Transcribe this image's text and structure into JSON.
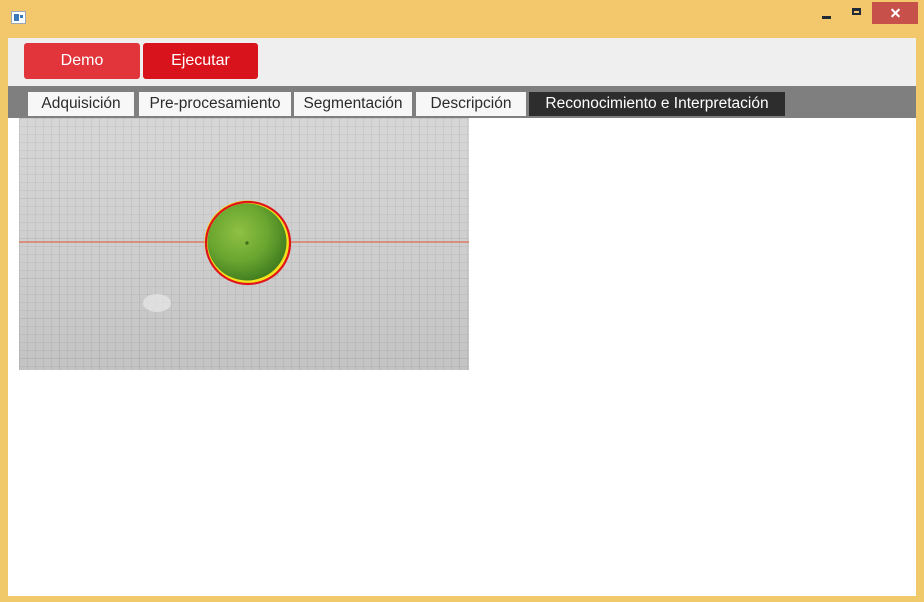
{
  "window": {
    "title": "",
    "icons": {
      "app": "app-icon",
      "minimize": "minimize-icon",
      "maximize": "maximize-icon",
      "close": "close-icon"
    },
    "colors": {
      "titlebar": "#f3c76c",
      "close_button": "#c7504b"
    }
  },
  "toolbar": {
    "buttons": [
      {
        "label": "Demo",
        "color": "#e1353b"
      },
      {
        "label": "Ejecutar",
        "color": "#d9131b"
      }
    ]
  },
  "tabs": {
    "items": [
      {
        "label": "Adquisición",
        "active": false
      },
      {
        "label": "Pre-procesamiento",
        "active": false
      },
      {
        "label": "Segmentación",
        "active": false
      },
      {
        "label": "Descripción",
        "active": false
      },
      {
        "label": "Reconocimiento e Interpretación",
        "active": true
      }
    ],
    "colors": {
      "strip": "#7f7f7f",
      "active_tab": "#2d2d2d"
    }
  },
  "content": {
    "image": {
      "subject": "green lime on grid paper with contour detection",
      "contour_colors": [
        "#e0141b",
        "#f2e21c"
      ]
    }
  }
}
